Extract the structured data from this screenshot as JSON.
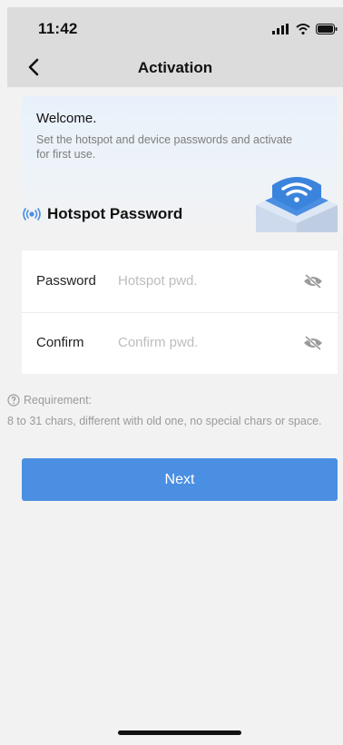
{
  "status_bar": {
    "time": "11:42"
  },
  "nav": {
    "title": "Activation"
  },
  "welcome": {
    "title": "Welcome.",
    "description": "Set the hotspot and device passwords and activate for first use."
  },
  "section": {
    "title": "Hotspot Password"
  },
  "form": {
    "password": {
      "label": "Password",
      "placeholder": "Hotspot pwd.",
      "value": ""
    },
    "confirm": {
      "label": "Confirm",
      "placeholder": "Confirm pwd.",
      "value": ""
    }
  },
  "requirement": {
    "title": "Requirement:",
    "text": "8 to 31 chars, different with old one, no special chars or space."
  },
  "next_button": {
    "label": "Next"
  },
  "colors": {
    "accent": "#4a8fe2",
    "bar_bg": "#dcdcdc",
    "page_bg": "#f2f2f2"
  },
  "icons": [
    "back-chevron-icon",
    "signal-icon",
    "wifi-icon",
    "battery-icon",
    "hotspot-icon",
    "eye-off-icon",
    "info-circle-icon",
    "router-illustration"
  ]
}
